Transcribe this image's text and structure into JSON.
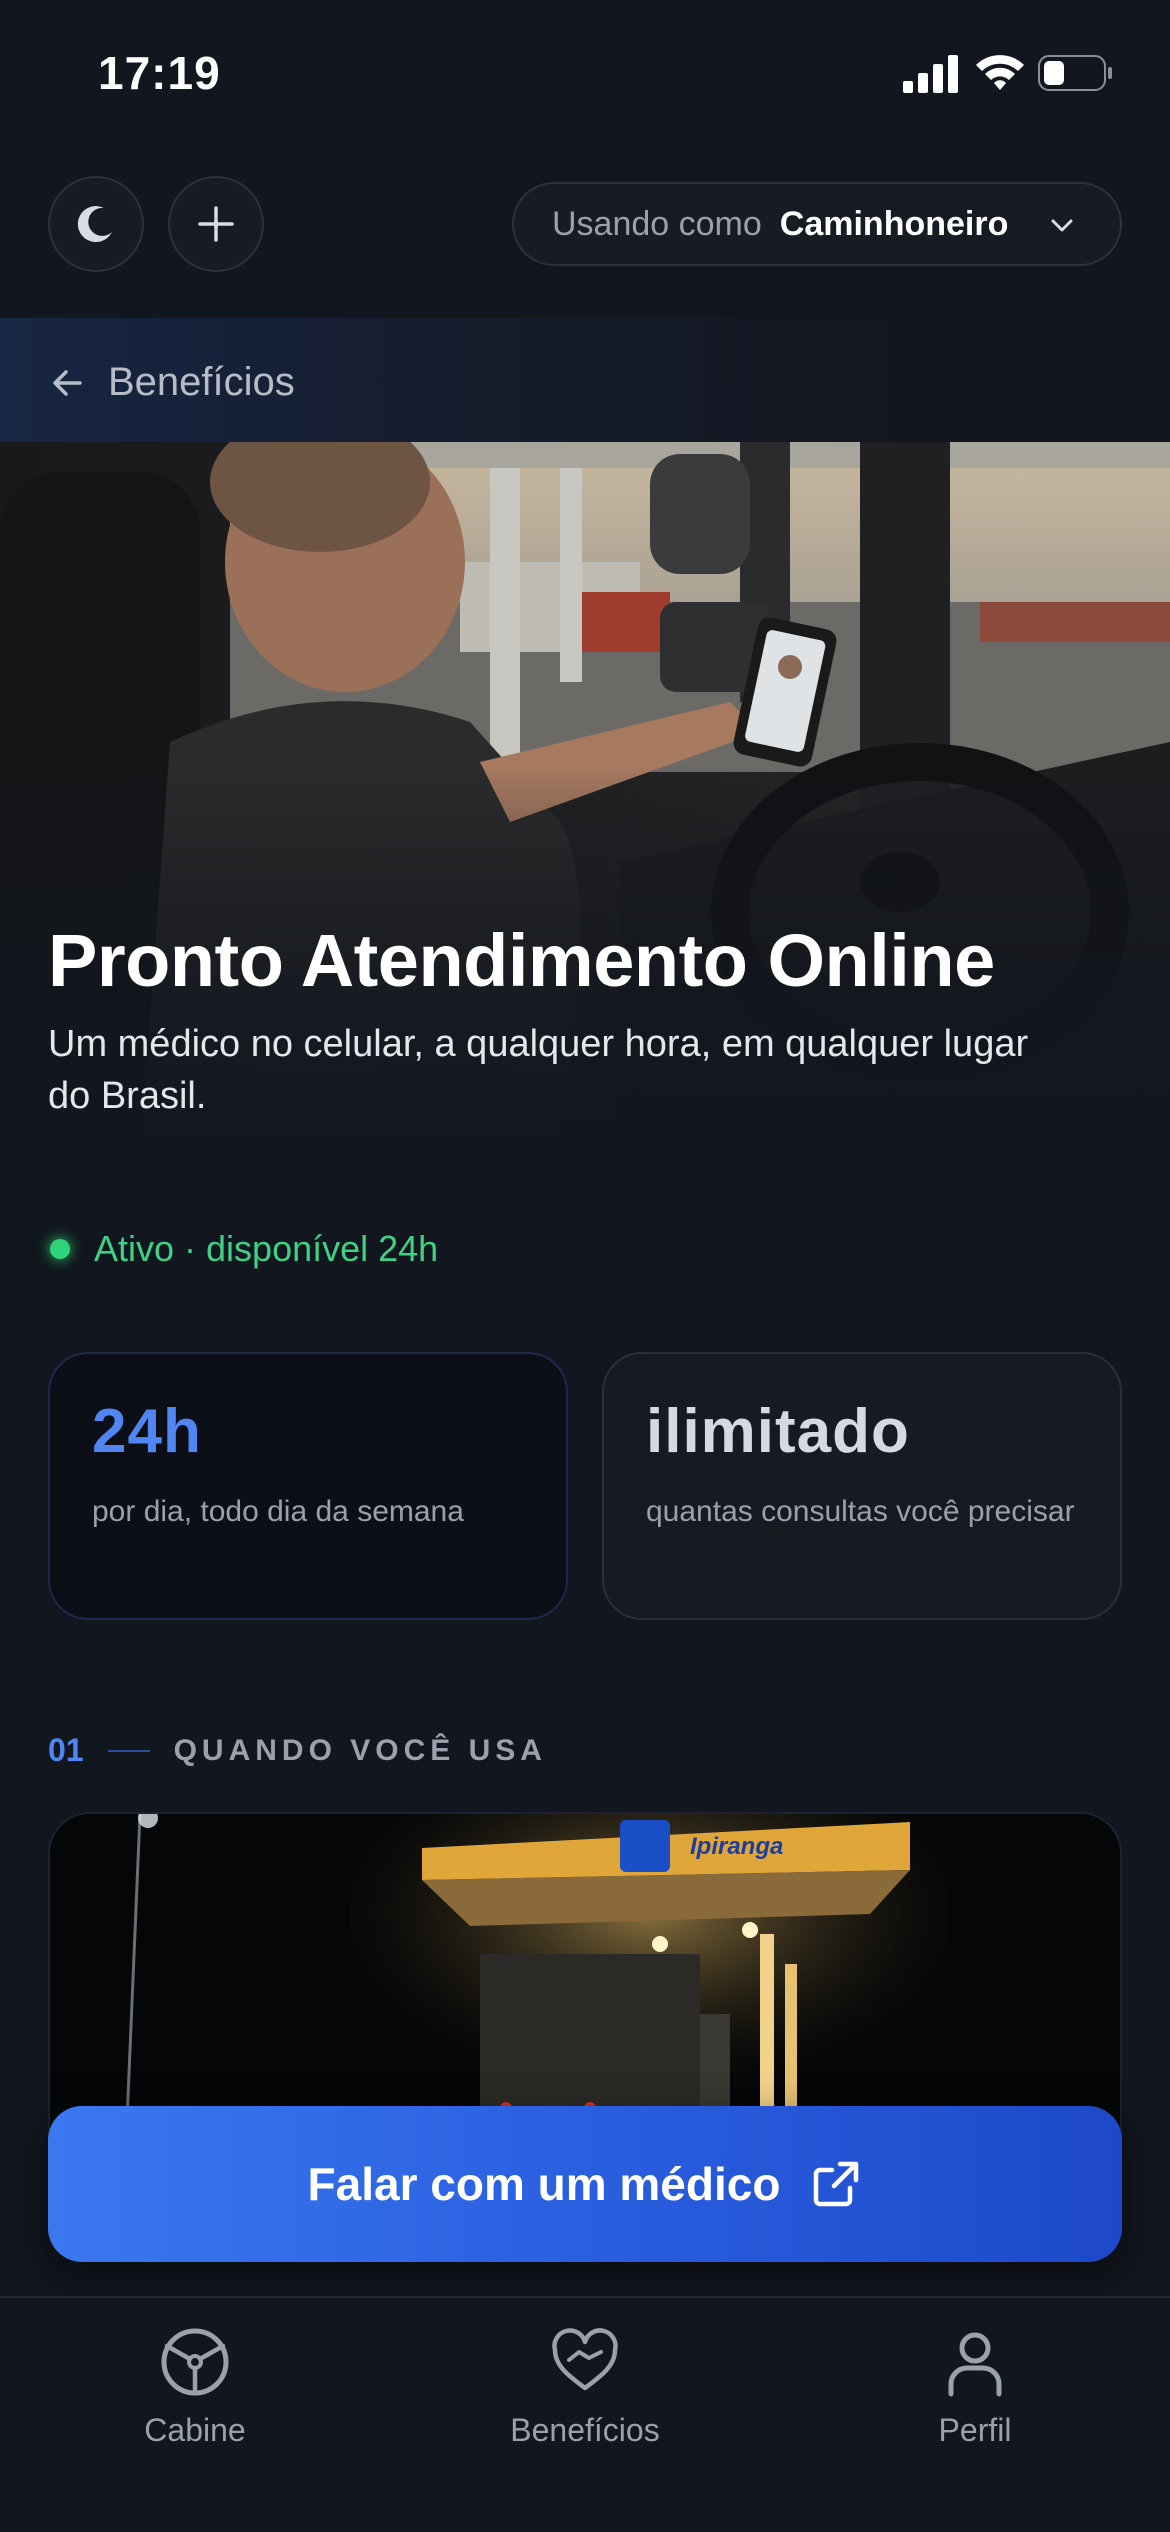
{
  "status_bar": {
    "time": "17:19"
  },
  "header": {
    "role_label": "Usando como",
    "role_value": "Caminhoneiro"
  },
  "nav": {
    "back_label": "Benefícios"
  },
  "hero": {
    "title": "Pronto Atendimento Online",
    "subtitle": "Um médico no celular, a qualquer hora, em qualquer lugar do Brasil."
  },
  "status": {
    "text": "Ativo · disponível 24h",
    "color": "#2fd47a"
  },
  "stats": [
    {
      "value": "24h",
      "caption": "por dia, todo dia da semana"
    },
    {
      "value": "ilimitado",
      "caption": "quantas consultas você precisar"
    }
  ],
  "section": {
    "number": "01",
    "title": "QUANDO VOCÊ USA"
  },
  "card": {
    "sign_text": "Ipiranga"
  },
  "cta": {
    "label": "Falar com um médico"
  },
  "tabs": [
    {
      "label": "Cabine",
      "icon": "steering-wheel-icon"
    },
    {
      "label": "Benefícios",
      "icon": "heart-hand-icon"
    },
    {
      "label": "Perfil",
      "icon": "person-icon"
    }
  ],
  "colors": {
    "accent": "#4f86f2",
    "cta": "#2a5fe0",
    "background": "#12161e"
  }
}
